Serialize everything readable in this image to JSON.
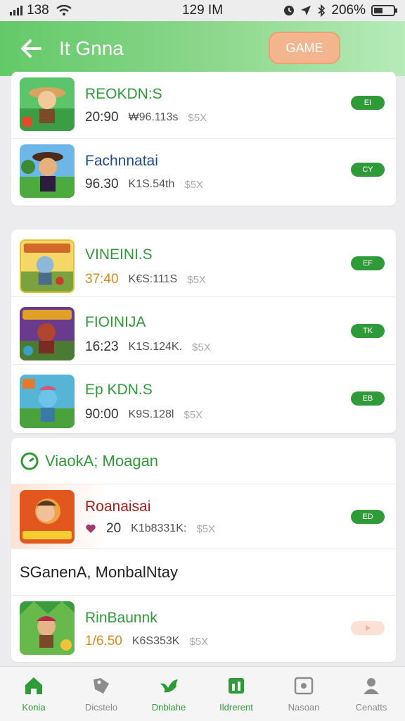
{
  "status": {
    "left": "138",
    "time": "129 IM",
    "battery": "206%"
  },
  "header": {
    "title": "It Gnna",
    "game_button": "GAME"
  },
  "group1": [
    {
      "name": "REOKDN:S",
      "time": "20:90",
      "price": "₩96.113s",
      "code": "$5X",
      "badge": "EI",
      "color": "green"
    },
    {
      "name": "Fachnnatai",
      "time": "96.30",
      "price": "K1S.54th",
      "code": "$5X",
      "badge": "CY",
      "color": "blue"
    }
  ],
  "group2": [
    {
      "name": "VINEINI.S",
      "time": "37:40",
      "price": "K€S:111S",
      "code": "$5X",
      "badge": "EF",
      "color": "green",
      "time_orange": true
    },
    {
      "name": "FIOINIJA",
      "time": "16:23",
      "price": "K1S.124K.",
      "code": "$5X",
      "badge": "TK",
      "color": "green"
    },
    {
      "name": "Ep KDN.S",
      "time": "90:00",
      "price": "K9S.128l",
      "code": "$5X",
      "badge": "EB",
      "color": "green"
    }
  ],
  "group3": {
    "section_title": "ViaokA; Moagan",
    "featured": {
      "name": "Roanaisai",
      "time": "20",
      "price": "K1b8331K:",
      "code": "$5X",
      "badge": "ED"
    },
    "banner": "SGanenA,  MonbalNtay",
    "last": {
      "name": "RinBaunnk",
      "time": "1/6.50",
      "price": "K6S353K",
      "code": "$5X",
      "badge": ""
    }
  },
  "nav": [
    {
      "label": "Konia",
      "icon": "home-icon"
    },
    {
      "label": "Dicstelo",
      "icon": "tag-icon"
    },
    {
      "label": "Dnblahe",
      "icon": "bird-icon"
    },
    {
      "label": "Ildrerent",
      "icon": "grid-icon"
    },
    {
      "label": "Nasoan",
      "icon": "photo-icon"
    },
    {
      "label": "Cenatts",
      "icon": "person-icon"
    }
  ],
  "colors": {
    "accent": "#2e9a38",
    "appbar": "#63c968",
    "game_button": "#f3b58d"
  }
}
